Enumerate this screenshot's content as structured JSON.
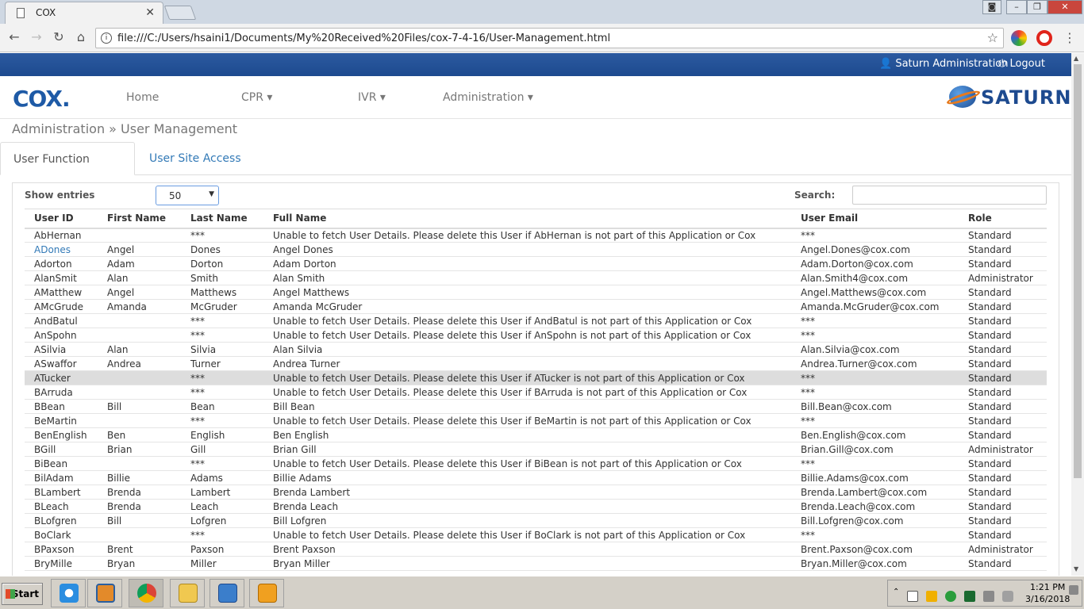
{
  "browser": {
    "tab_title": "COX",
    "tab_close": "✕",
    "url": "file:///C:/Users/hsaini1/Documents/My%20Received%20Files/cox-7-4-16/User-Management.html"
  },
  "header": {
    "user_name": "Saturn Administration",
    "logout": "Logout"
  },
  "logo": {
    "left": "COX",
    "right": "SATURN"
  },
  "nav": {
    "home": "Home",
    "cpr": "CPR",
    "ivr": "IVR",
    "administration": "Administration"
  },
  "breadcrumb": "Administration » User Management",
  "tabs": {
    "active": "User Function Access",
    "inactive": "User Site Access"
  },
  "controls": {
    "show_entries": "Show entries",
    "entries_value": "50",
    "search_label": "Search:"
  },
  "table": {
    "headers": [
      "User ID",
      "First Name",
      "Last Name",
      "Full Name",
      "User Email",
      "Role"
    ],
    "rows": [
      [
        "AbHernan",
        "",
        "***",
        "Unable to fetch User Details. Please delete this User if AbHernan is not part of this Application or Cox",
        "***",
        "Standard"
      ],
      [
        "ADones",
        "Angel",
        "Dones",
        "Angel Dones",
        "Angel.Dones@cox.com",
        "Standard"
      ],
      [
        "Adorton",
        "Adam",
        "Dorton",
        "Adam Dorton",
        "Adam.Dorton@cox.com",
        "Standard"
      ],
      [
        "AlanSmit",
        "Alan",
        "Smith",
        "Alan Smith",
        "Alan.Smith4@cox.com",
        "Administrator"
      ],
      [
        "AMatthew",
        "Angel",
        "Matthews",
        "Angel Matthews",
        "Angel.Matthews@cox.com",
        "Standard"
      ],
      [
        "AMcGrude",
        "Amanda",
        "McGruder",
        "Amanda McGruder",
        "Amanda.McGruder@cox.com",
        "Standard"
      ],
      [
        "AndBatul",
        "",
        "***",
        "Unable to fetch User Details. Please delete this User if AndBatul is not part of this Application or Cox",
        "***",
        "Standard"
      ],
      [
        "AnSpohn",
        "",
        "***",
        "Unable to fetch User Details. Please delete this User if AnSpohn is not part of this Application or Cox",
        "***",
        "Standard"
      ],
      [
        "ASilvia",
        "Alan",
        "Silvia",
        "Alan Silvia",
        "Alan.Silvia@cox.com",
        "Standard"
      ],
      [
        "ASwaffor",
        "Andrea",
        "Turner",
        "Andrea Turner",
        "Andrea.Turner@cox.com",
        "Standard"
      ],
      [
        "ATucker",
        "",
        "***",
        "Unable to fetch User Details. Please delete this User if ATucker is not part of this Application or Cox",
        "***",
        "Standard"
      ],
      [
        "BArruda",
        "",
        "***",
        "Unable to fetch User Details. Please delete this User if BArruda is not part of this Application or Cox",
        "***",
        "Standard"
      ],
      [
        "BBean",
        "Bill",
        "Bean",
        "Bill Bean",
        "Bill.Bean@cox.com",
        "Standard"
      ],
      [
        "BeMartin",
        "",
        "***",
        "Unable to fetch User Details. Please delete this User if BeMartin is not part of this Application or Cox",
        "***",
        "Standard"
      ],
      [
        "BenEnglish",
        "Ben",
        "English",
        "Ben English",
        "Ben.English@cox.com",
        "Standard"
      ],
      [
        "BGill",
        "Brian",
        "Gill",
        "Brian Gill",
        "Brian.Gill@cox.com",
        "Administrator"
      ],
      [
        "BiBean",
        "",
        "***",
        "Unable to fetch User Details. Please delete this User if BiBean is not part of this Application or Cox",
        "***",
        "Standard"
      ],
      [
        "BilAdam",
        "Billie",
        "Adams",
        "Billie Adams",
        "Billie.Adams@cox.com",
        "Standard"
      ],
      [
        "BLambert",
        "Brenda",
        "Lambert",
        "Brenda Lambert",
        "Brenda.Lambert@cox.com",
        "Standard"
      ],
      [
        "BLeach",
        "Brenda",
        "Leach",
        "Brenda Leach",
        "Brenda.Leach@cox.com",
        "Standard"
      ],
      [
        "BLofgren",
        "Bill",
        "Lofgren",
        "Bill Lofgren",
        "Bill.Lofgren@cox.com",
        "Standard"
      ],
      [
        "BoClark",
        "",
        "***",
        "Unable to fetch User Details. Please delete this User if BoClark is not part of this Application or Cox",
        "***",
        "Standard"
      ],
      [
        "BPaxson",
        "Brent",
        "Paxson",
        "Brent Paxson",
        "Brent.Paxson@cox.com",
        "Administrator"
      ],
      [
        "BryMille",
        "Bryan",
        "Miller",
        "Bryan Miller",
        "Bryan.Miller@cox.com",
        "Standard"
      ]
    ],
    "highlighted_row": 10,
    "link_row": 1
  },
  "taskbar": {
    "start": "Start",
    "time": "1:21 PM",
    "date": "3/16/2018"
  },
  "colors": {
    "header_bar": "#2c5aa0",
    "link": "#337ab7",
    "accent_orange": "#e67a1e"
  }
}
